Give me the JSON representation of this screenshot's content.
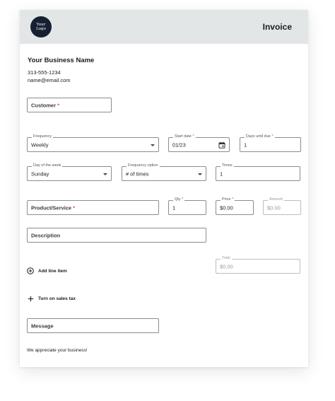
{
  "header": {
    "logo_line1": "Your",
    "logo_line2": "Logo",
    "title": "Invoice"
  },
  "business": {
    "name": "Your Business Name",
    "phone": "313-555-1234",
    "email": "name@email.com"
  },
  "form": {
    "customer": {
      "label": "Customer",
      "required_mark": "*"
    },
    "frequency": {
      "label": "Frequency",
      "value": "Weekly"
    },
    "start_date": {
      "label": "Start date",
      "required_mark": "*",
      "value": "01/23"
    },
    "days_until_due": {
      "label": "Days until due",
      "required_mark": "*",
      "value": "1"
    },
    "day_of_week": {
      "label": "Day of the week",
      "value": "Sunday"
    },
    "frequency_option": {
      "label": "Frequency option",
      "value": "# of times"
    },
    "times": {
      "label": "Times",
      "value": "1"
    },
    "product_service": {
      "label": "Product/Service",
      "required_mark": "*"
    },
    "qty": {
      "label": "Qty",
      "required_mark": "*",
      "value": "1"
    },
    "price": {
      "label": "Price",
      "required_mark": "*",
      "value": "$0.00"
    },
    "amount": {
      "label": "Amount",
      "value": "$0.00"
    },
    "description": {
      "label": "Description"
    },
    "total": {
      "label": "Total",
      "value": "$0.00"
    },
    "message": {
      "label": "Message"
    }
  },
  "actions": {
    "add_line_item": "Add line item",
    "sales_tax": "Turn on sales tax"
  },
  "footer": {
    "note": "We appreciate your business!"
  },
  "colors": {
    "header_bg": "#e3e6e6",
    "logo_bg": "#162033",
    "required_accent": "#e8502a"
  }
}
